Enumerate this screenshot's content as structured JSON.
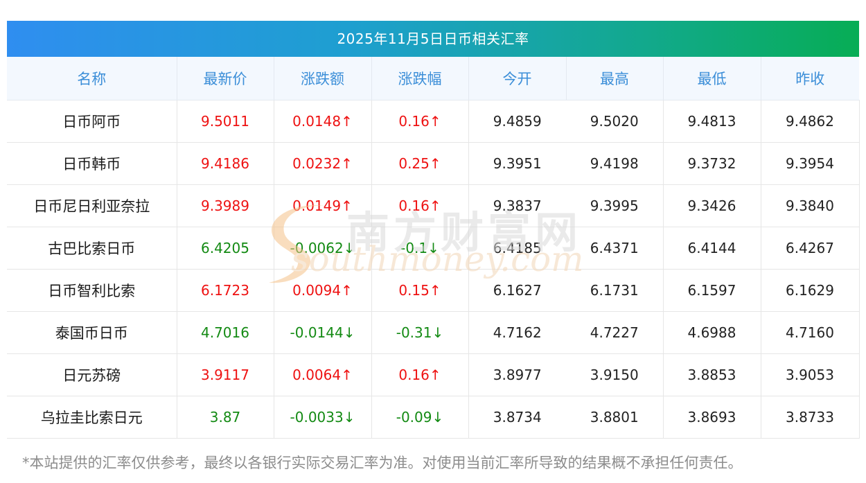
{
  "title": "2025年11月5日日币相关汇率",
  "headers": [
    "名称",
    "最新价",
    "涨跌额",
    "涨跌幅",
    "今开",
    "最高",
    "最低",
    "昨收"
  ],
  "rows": [
    {
      "name": "日币阿币",
      "latest": "9.5011",
      "change": "0.0148↑",
      "pct": "0.16↑",
      "open": "9.4859",
      "high": "9.5020",
      "low": "9.4813",
      "prev": "9.4862",
      "trend": "up"
    },
    {
      "name": "日币韩币",
      "latest": "9.4186",
      "change": "0.0232↑",
      "pct": "0.25↑",
      "open": "9.3951",
      "high": "9.4198",
      "low": "9.3732",
      "prev": "9.3954",
      "trend": "up"
    },
    {
      "name": "日币尼日利亚奈拉",
      "latest": "9.3989",
      "change": "0.0149↑",
      "pct": "0.16↑",
      "open": "9.3837",
      "high": "9.3995",
      "low": "9.3426",
      "prev": "9.3840",
      "trend": "up"
    },
    {
      "name": "古巴比索日币",
      "latest": "6.4205",
      "change": "-0.0062↓",
      "pct": "-0.1↓",
      "open": "6.4185",
      "high": "6.4371",
      "low": "6.4144",
      "prev": "6.4267",
      "trend": "down"
    },
    {
      "name": "日币智利比索",
      "latest": "6.1723",
      "change": "0.0094↑",
      "pct": "0.15↑",
      "open": "6.1627",
      "high": "6.1731",
      "low": "6.1597",
      "prev": "6.1629",
      "trend": "up"
    },
    {
      "name": "泰国币日币",
      "latest": "4.7016",
      "change": "-0.0144↓",
      "pct": "-0.31↓",
      "open": "4.7162",
      "high": "4.7227",
      "low": "4.6988",
      "prev": "4.7160",
      "trend": "down"
    },
    {
      "name": "日元苏磅",
      "latest": "3.9117",
      "change": "0.0064↑",
      "pct": "0.16↑",
      "open": "3.8977",
      "high": "3.9150",
      "low": "3.8853",
      "prev": "3.9053",
      "trend": "up"
    },
    {
      "name": "乌拉圭比索日元",
      "latest": "3.87",
      "change": "-0.0033↓",
      "pct": "-0.09↓",
      "open": "3.8734",
      "high": "3.8801",
      "low": "3.8693",
      "prev": "3.8733",
      "trend": "down"
    }
  ],
  "footnote": "*本站提供的汇率仅供参考，最终以各银行实际交易汇率为准。对使用当前汇率所导致的结果概不承担任何责任。",
  "watermark": {
    "cn": "南方财富网",
    "en": "southmoney.com"
  },
  "colors": {
    "up": "#ee1111",
    "down": "#138a13",
    "header_text": "#3b8ed8",
    "title_gradient_start": "#2f8ef0",
    "title_gradient_end": "#07ad55"
  }
}
